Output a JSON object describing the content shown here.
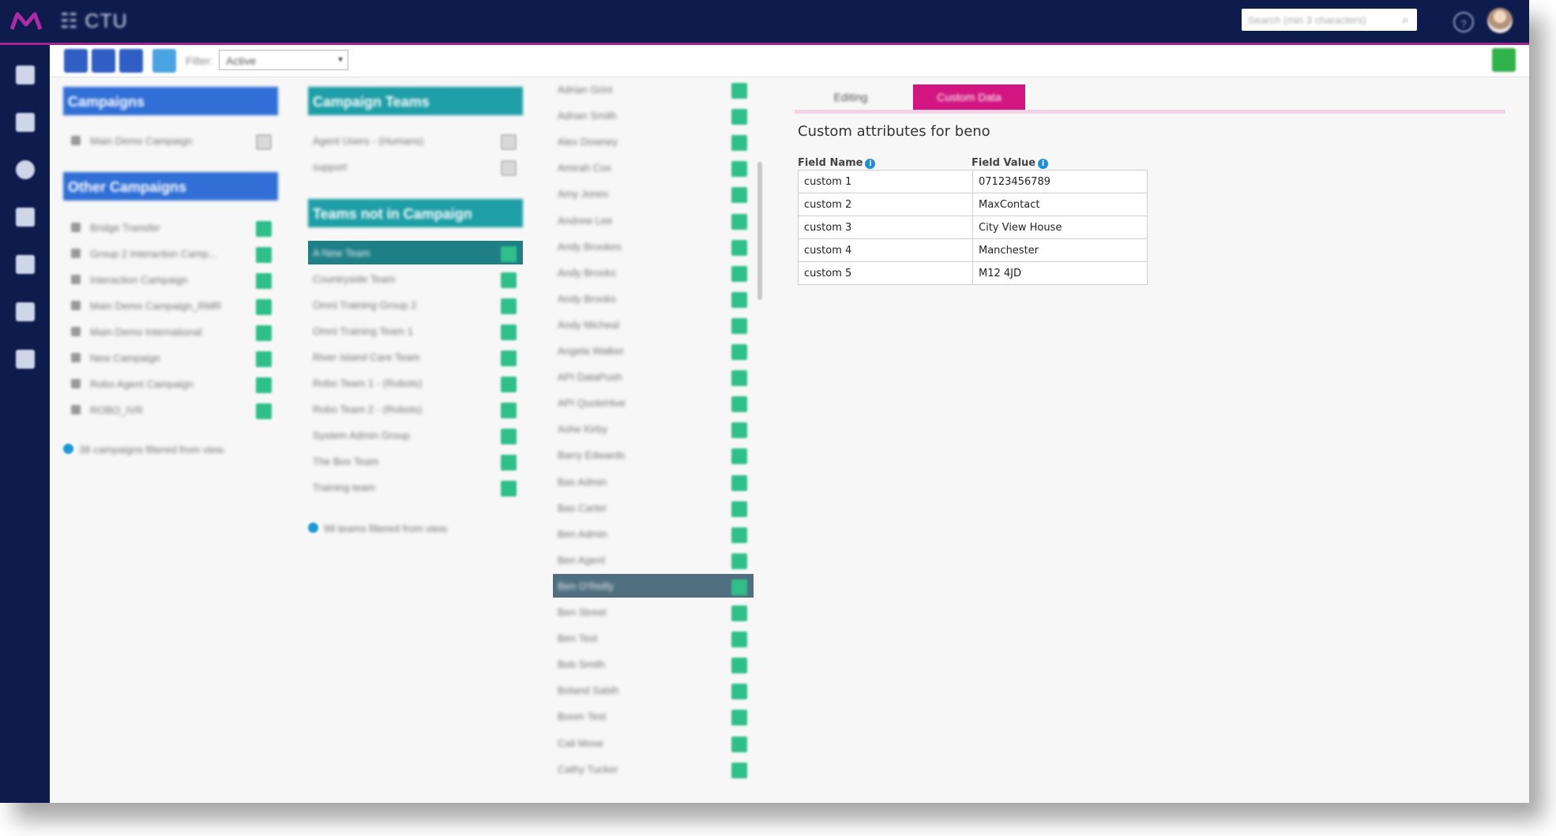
{
  "app": {
    "title": "CTU"
  },
  "header": {
    "search_placeholder": "Search (min 3 characters)"
  },
  "toolbar": {
    "filter_label": "Filter:",
    "filter_value": "Active"
  },
  "campaigns": {
    "title": "Campaigns",
    "items": [
      {
        "label": "Main Demo Campaign"
      }
    ]
  },
  "other_campaigns": {
    "title": "Other Campaigns",
    "items": [
      {
        "label": "Bridge Transfer"
      },
      {
        "label": "Group 2 Interaction Camp..."
      },
      {
        "label": "Interaction Campaign"
      },
      {
        "label": "Main Demo Campaign_RMR"
      },
      {
        "label": "Main Demo International"
      },
      {
        "label": "New Campaign"
      },
      {
        "label": "Robo Agent Campaign"
      },
      {
        "label": "ROBO_IVR"
      }
    ],
    "footer": "38 campaigns filtered from view."
  },
  "campaign_teams": {
    "title": "Campaign Teams",
    "items": [
      {
        "label": "Agent Users - (Humans)"
      },
      {
        "label": "support"
      }
    ]
  },
  "teams_not_in_campaign": {
    "title": "Teams not in Campaign",
    "items": [
      {
        "label": "A New Team"
      },
      {
        "label": "Countryside Team"
      },
      {
        "label": "Omni Training Group 2"
      },
      {
        "label": "Omni Training Team 1"
      },
      {
        "label": "River Island Care Team"
      },
      {
        "label": "Robo Team 1 - (Robots)"
      },
      {
        "label": "Robo Team 2 - (Robots)"
      },
      {
        "label": "System Admin Group"
      },
      {
        "label": "The Box Team"
      },
      {
        "label": "Training team"
      }
    ],
    "footer": "98 teams filtered from view."
  },
  "users": {
    "items": [
      {
        "label": "Adrian Grint"
      },
      {
        "label": "Adrian Smith"
      },
      {
        "label": "Alex Downey"
      },
      {
        "label": "Amirah Cox"
      },
      {
        "label": "Amy Jones"
      },
      {
        "label": "Andrew Lee"
      },
      {
        "label": "Andy Brookes"
      },
      {
        "label": "Andy Brooks"
      },
      {
        "label": "Andy Brooks"
      },
      {
        "label": "Andy Micheal"
      },
      {
        "label": "Angela Walker"
      },
      {
        "label": "API DataPush"
      },
      {
        "label": "API QuoteHive"
      },
      {
        "label": "Ashe Kirby"
      },
      {
        "label": "Barry Edwards"
      },
      {
        "label": "Bas Admin"
      },
      {
        "label": "Bas Carter"
      },
      {
        "label": "Ben Admin"
      },
      {
        "label": "Ben Agent"
      },
      {
        "label": "Ben O'Reilly"
      },
      {
        "label": "Ben Street"
      },
      {
        "label": "Ben Test"
      },
      {
        "label": "Bob Smith"
      },
      {
        "label": "Boland Sabih"
      },
      {
        "label": "Boom Test"
      },
      {
        "label": "Cali Mose"
      },
      {
        "label": "Cathy Tucker"
      }
    ]
  },
  "tabs": [
    {
      "label": "Editing"
    },
    {
      "label": "Custom Data"
    }
  ],
  "custom_data": {
    "title": "Custom attributes for beno",
    "field_name_header": "Field Name",
    "field_value_header": "Field Value",
    "rows": [
      {
        "name": "custom 1",
        "value": "07123456789"
      },
      {
        "name": "custom 2",
        "value": "MaxContact"
      },
      {
        "name": "custom 3",
        "value": "City View House"
      },
      {
        "name": "custom 4",
        "value": "Manchester"
      },
      {
        "name": "custom 5",
        "value": "M12 4JD"
      }
    ]
  },
  "colors": {
    "navbar": "#0d1b4d",
    "accent": "#d21581",
    "blue_header": "#2f6fd6",
    "teal_header": "#1e9ea6",
    "add_green": "#2fbf8a"
  }
}
